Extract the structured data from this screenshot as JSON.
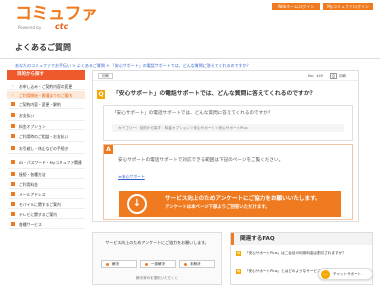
{
  "header": {
    "logo_text": "コミュファ",
    "logo_sub": "Powered by",
    "logo_brand": "ctc",
    "btn_home": "Webホームログイン",
    "btn_family": "Myコミュファログイン"
  },
  "page": {
    "title": "よくあるご質問",
    "breadcrumb": "あなたのコミュファでお手伝い > よくあるご質問 > 「安心サポート」の電話サポートでは、どんな質問に答えてくれるのですか？"
  },
  "sidebar": {
    "heading": "目的から探す",
    "items": [
      {
        "label": "お申し込み・ご契約内容の変更",
        "icon": "chevron-right-icon",
        "active": false
      },
      {
        "label": "ご利用開始・開通までのご案内",
        "icon": "chevron-right-icon",
        "active": true
      },
      {
        "label": "ご契約内容・変更・解約",
        "icon": "square-bullet-icon",
        "active": false
      },
      {
        "label": "お支払い",
        "icon": "square-bullet-icon",
        "active": false
      },
      {
        "label": "料金オプション",
        "icon": "square-bullet-icon",
        "active": false
      },
      {
        "label": "ご利用時のご相談・お支払い",
        "icon": "square-bullet-icon",
        "active": false
      },
      {
        "label": "お引越し・休止などの手続き",
        "icon": "square-bullet-icon",
        "active": false
      },
      {
        "label": "ID・パスワード・Myコミュファ関連",
        "icon": "square-bullet-icon",
        "active": false
      },
      {
        "label": "接続・各種方法",
        "icon": "square-bullet-icon",
        "active": false
      },
      {
        "label": "ご利用料金",
        "icon": "square-bullet-icon",
        "active": false
      },
      {
        "label": "メールアドレス",
        "icon": "square-bullet-icon",
        "active": false
      },
      {
        "label": "モバイルに関するご案内",
        "icon": "square-bullet-icon",
        "active": false
      },
      {
        "label": "テレビに関するご案内",
        "icon": "square-bullet-icon",
        "active": false
      },
      {
        "label": "各種サービス",
        "icon": "square-bullet-icon",
        "active": false
      }
    ]
  },
  "meta": {
    "print_label": "印刷",
    "qno": "No：449",
    "print_icon": "print-icon",
    "print_text": "印刷"
  },
  "question": {
    "badge": "Q",
    "title": "「安心サポート」の電話サポートでは、どんな質問に答えてくれるのですか？",
    "body": "「安心サポート」の電話サポートでは、どんな質問に答えてくれるのですか？",
    "categories": "カテゴリー：目的から探す：料金オプション＞安心サポート＞安心サポートPlus"
  },
  "answer": {
    "badge": "A",
    "text": "安心サポートの電話サポートで対応できる範囲は下記のページをご覧ください。",
    "link": "≫安心サポート",
    "survey_icon": "arrow-down-circle-icon",
    "survey_line1": "サービス向上のためアンケートにご協力をお願いいたします。",
    "survey_line2": "アンケートは本ページ下部よりご回答いただけます。"
  },
  "feedback": {
    "title": "サービス向上のためアンケートにご協力をお願いします。",
    "buttons": [
      "解決",
      "一部解決",
      "未解決"
    ],
    "note": "解決済みを選択いただくと"
  },
  "related": {
    "heading": "関連するFAQ",
    "items": [
      {
        "badge": "Q",
        "text": "「安心サポートPlus」は二台目の利用料金は割引されますか？"
      },
      {
        "badge": "Q",
        "text": "「安心サポートPlus」とはどのようなサービスですか？"
      }
    ]
  },
  "chat": {
    "icon": "chat-icon",
    "label": "チャットサポート"
  },
  "colors": {
    "brand_orange": "#f07a1f",
    "accent_yellow": "#f5a800",
    "sidebar_head": "#ee5a2b",
    "link_blue": "#3366cc"
  }
}
